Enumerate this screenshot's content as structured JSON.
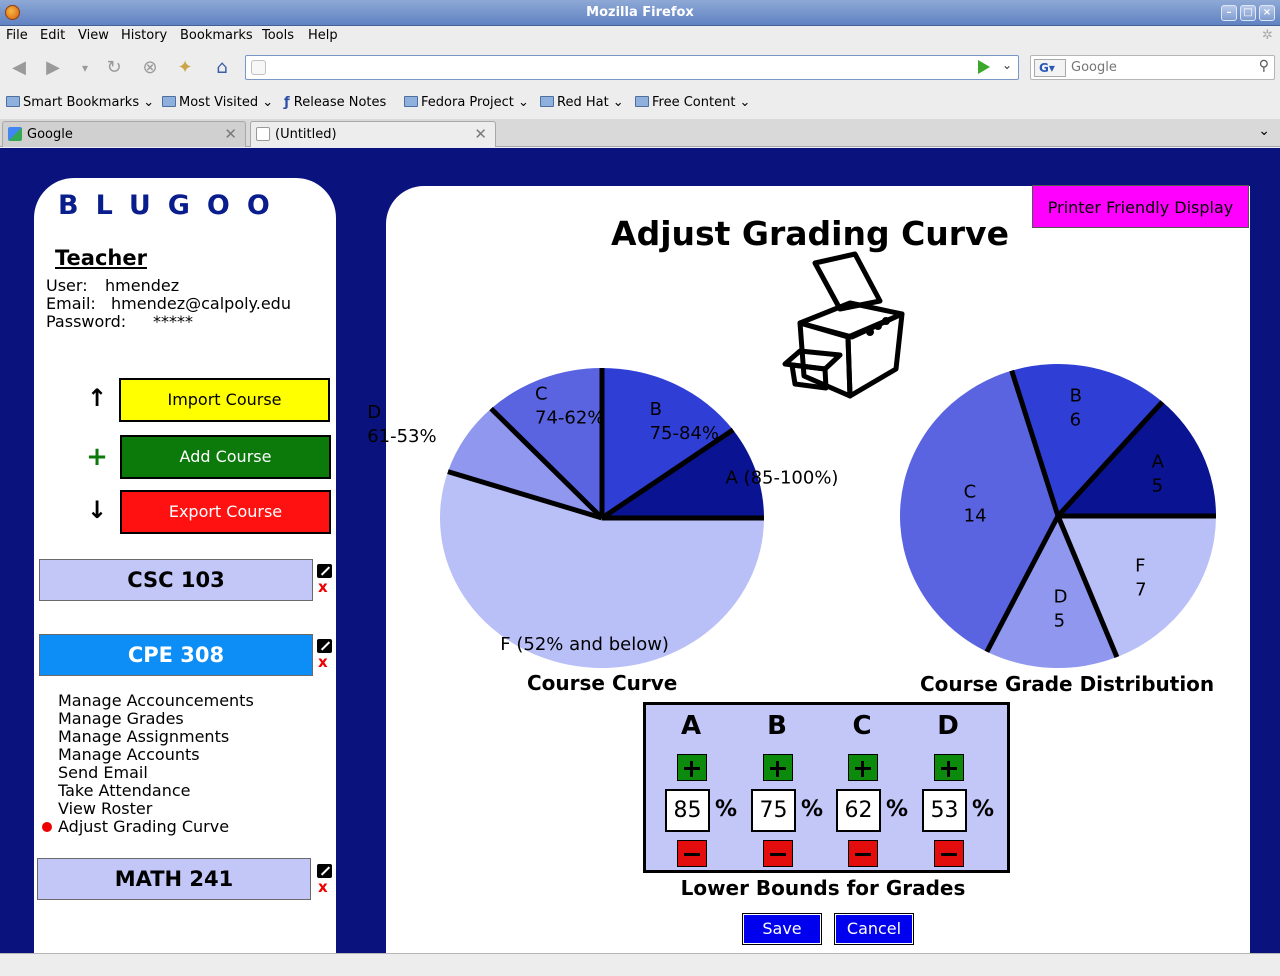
{
  "window": {
    "title": "Mozilla Firefox"
  },
  "menu": [
    "File",
    "Edit",
    "View",
    "History",
    "Bookmarks",
    "Tools",
    "Help"
  ],
  "navbar": {
    "url": "",
    "search_placeholder": "Google",
    "search_engine": "G"
  },
  "bookmarks": [
    {
      "label": "Smart Bookmarks",
      "icon": "folder-icon",
      "dropdown": true
    },
    {
      "label": "Most Visited",
      "icon": "folder-icon",
      "dropdown": true
    },
    {
      "label": "Release Notes",
      "icon": "fedora-icon",
      "dropdown": false
    },
    {
      "label": "Fedora Project",
      "icon": "folder-icon",
      "dropdown": true
    },
    {
      "label": "Red Hat",
      "icon": "folder-icon",
      "dropdown": true
    },
    {
      "label": "Free Content",
      "icon": "folder-icon",
      "dropdown": true
    }
  ],
  "tabs": [
    {
      "label": "Google",
      "active": false
    },
    {
      "label": "(Untitled)",
      "active": true
    }
  ],
  "sidebar": {
    "logo": "BLUGOO",
    "role": "Teacher",
    "user_label": "User:",
    "user": "hmendez",
    "email_label": "Email:",
    "email": "hmendez@calpoly.edu",
    "password_label": "Password:",
    "password": "*****",
    "actions": [
      {
        "label": "Import Course",
        "icon": "↑",
        "color": "#ffff00",
        "text_color": "#000000"
      },
      {
        "label": "Add Course",
        "icon": "+",
        "color": "#0b7a0b",
        "text_color": "#ffffff"
      },
      {
        "label": "Export Course",
        "icon": "↓",
        "color": "#ff1111",
        "text_color": "#ffffff"
      }
    ],
    "courses": [
      {
        "label": "CSC 103",
        "selected": false
      },
      {
        "label": "CPE 308",
        "selected": true
      },
      {
        "label": "MATH 241",
        "selected": false
      }
    ],
    "course_menu": [
      "Manage Accouncements",
      "Manage Grades",
      "Manage Assignments",
      "Manage Accounts",
      "Send Email",
      "Take Attendance",
      "View Roster",
      "Adjust Grading Curve"
    ],
    "course_menu_active": "Adjust Grading Curve"
  },
  "main": {
    "print_button": "Printer Friendly Display",
    "title": "Adjust Grading Curve",
    "curve_caption": "Course Curve",
    "distribution_caption": "Course Grade Distribution",
    "lower_bounds_label": "Lower Bounds for Grades",
    "save_label": "Save",
    "cancel_label": "Cancel",
    "grades": [
      {
        "letter": "A",
        "value": "85"
      },
      {
        "letter": "B",
        "value": "75"
      },
      {
        "letter": "C",
        "value": "62"
      },
      {
        "letter": "D",
        "value": "53"
      }
    ],
    "pct_symbol": "%"
  },
  "chart_data": [
    {
      "type": "pie",
      "title": "Course Curve",
      "labels": [
        "A (85-100%)",
        "B 75-84%",
        "C 74-62%",
        "D 61-53%",
        "F (52% and below)"
      ],
      "values": [
        10,
        15,
        12,
        8,
        55
      ],
      "colors": [
        "#0a1391",
        "#2f3fd6",
        "#5a64e0",
        "#8f97ee",
        "#b9bff7"
      ]
    },
    {
      "type": "pie",
      "title": "Course Grade Distribution",
      "labels": [
        "A",
        "B",
        "C",
        "D",
        "F"
      ],
      "values": [
        5,
        6,
        14,
        5,
        7
      ],
      "colors": [
        "#0a1391",
        "#2f3fd6",
        "#5a64e0",
        "#8f97ee",
        "#b9bff7"
      ]
    }
  ]
}
